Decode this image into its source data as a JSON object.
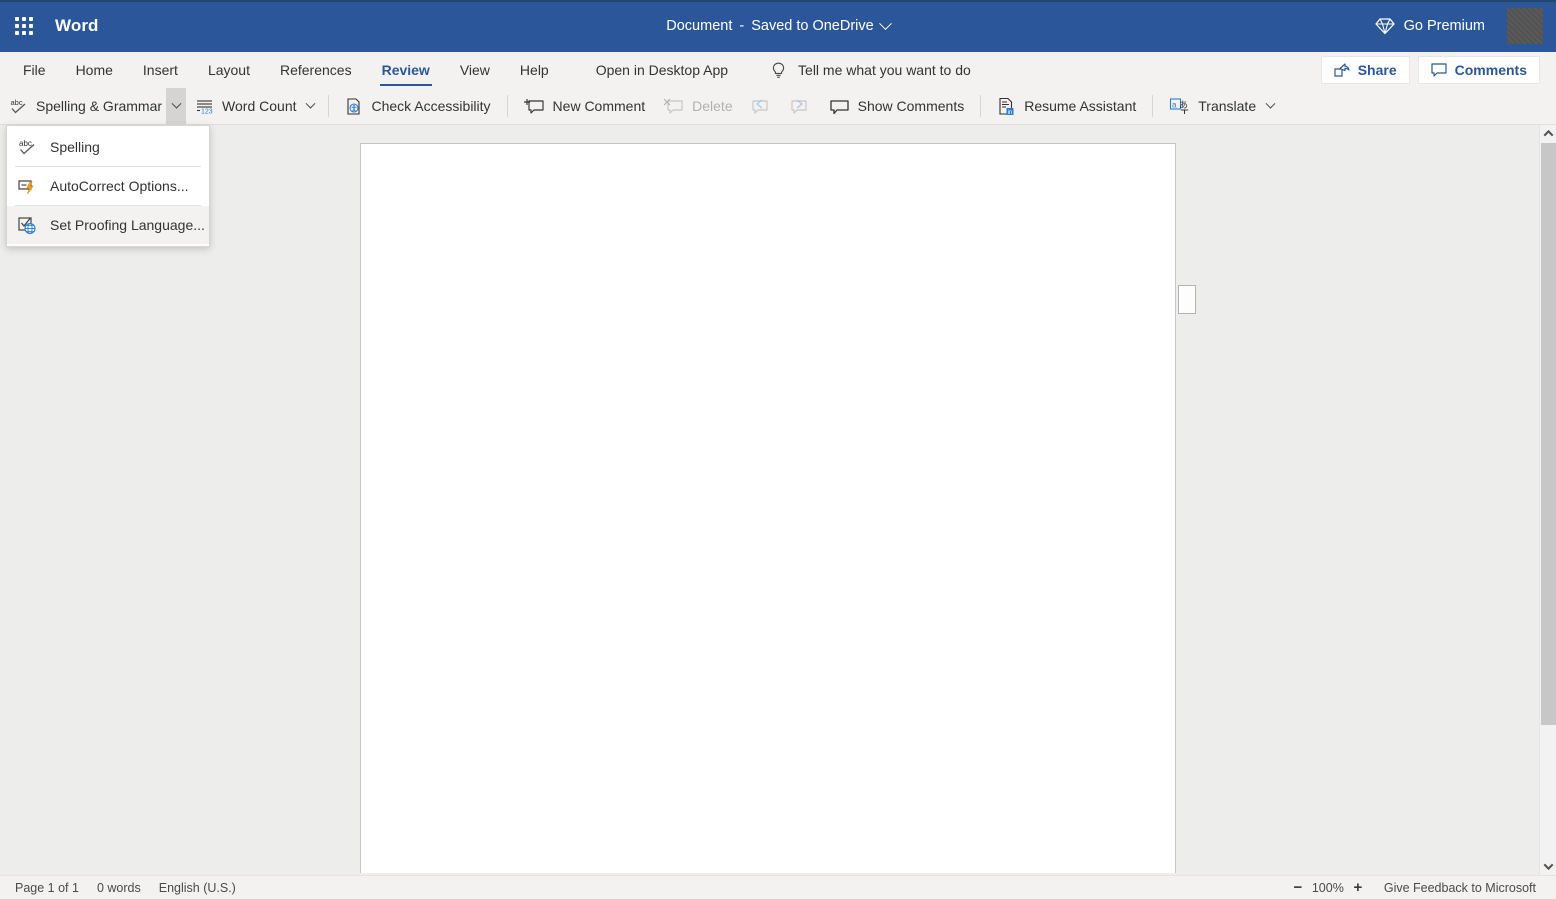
{
  "titlebar": {
    "app_name": "Word",
    "waffle_icon": "app-launcher-icon",
    "document_name": "Document",
    "separator": "-",
    "save_state": "Saved to OneDrive",
    "go_premium": "Go Premium",
    "premium_icon": "diamond-icon",
    "avatar": "user-avatar",
    "bg_color": "#2b579a"
  },
  "tabs": [
    {
      "label": "File",
      "active": false
    },
    {
      "label": "Home",
      "active": false
    },
    {
      "label": "Insert",
      "active": false
    },
    {
      "label": "Layout",
      "active": false
    },
    {
      "label": "References",
      "active": false
    },
    {
      "label": "Review",
      "active": true
    },
    {
      "label": "View",
      "active": false
    },
    {
      "label": "Help",
      "active": false
    }
  ],
  "tabbar": {
    "open_in_desktop_app": "Open in Desktop App",
    "tell_me_placeholder": "Tell me what you want to do",
    "tell_me_icon": "lightbulb-icon",
    "share_label": "Share",
    "share_icon": "share-icon",
    "comments_label": "Comments",
    "comments_icon": "comment-icon",
    "accent_color": "#2b579a"
  },
  "ribbon": {
    "items": [
      {
        "label": "Spelling & Grammar",
        "icon": "abc-check-icon",
        "has_caret": true,
        "caret_open": true,
        "disabled": false
      },
      {
        "label": "Word Count",
        "icon": "word-count-icon",
        "has_caret": true,
        "caret_open": false,
        "disabled": false
      },
      {
        "label": "Check Accessibility",
        "icon": "accessibility-icon",
        "has_caret": false,
        "disabled": false
      },
      {
        "label": "New Comment",
        "icon": "new-comment-icon",
        "has_caret": false,
        "disabled": false
      },
      {
        "label": "Delete",
        "icon": "delete-comment-icon",
        "has_caret": false,
        "disabled": true
      },
      {
        "label": "",
        "icon": "previous-comment-icon",
        "has_caret": false,
        "disabled": true
      },
      {
        "label": "",
        "icon": "next-comment-icon",
        "has_caret": false,
        "disabled": true
      },
      {
        "label": "Show Comments",
        "icon": "show-comments-icon",
        "has_caret": false,
        "disabled": false
      },
      {
        "label": "Resume Assistant",
        "icon": "resume-assistant-icon",
        "has_caret": false,
        "disabled": false
      },
      {
        "label": "Translate",
        "icon": "translate-icon",
        "has_caret": true,
        "caret_open": false,
        "disabled": false
      }
    ]
  },
  "spelling_menu": {
    "open": true,
    "items": [
      {
        "label": "Spelling",
        "icon": "abc-check-icon",
        "hover": false
      },
      {
        "label": "AutoCorrect Options...",
        "icon": "autocorrect-icon",
        "hover": false
      },
      {
        "label": "Set Proofing Language...",
        "icon": "proofing-language-icon",
        "hover": true
      }
    ]
  },
  "statusbar": {
    "page_info": "Page 1 of 1",
    "word_count": "0 words",
    "language": "English (U.S.)",
    "zoom_out_icon": "minus-icon",
    "zoom_level": "100%",
    "zoom_in_icon": "plus-icon",
    "feedback": "Give Feedback to Microsoft"
  },
  "workspace": {
    "page_background": "#ffffff",
    "canvas_background": "#ededeb",
    "scroll_up_icon": "chevron-up-icon",
    "scroll_down_icon": "chevron-down-icon"
  }
}
